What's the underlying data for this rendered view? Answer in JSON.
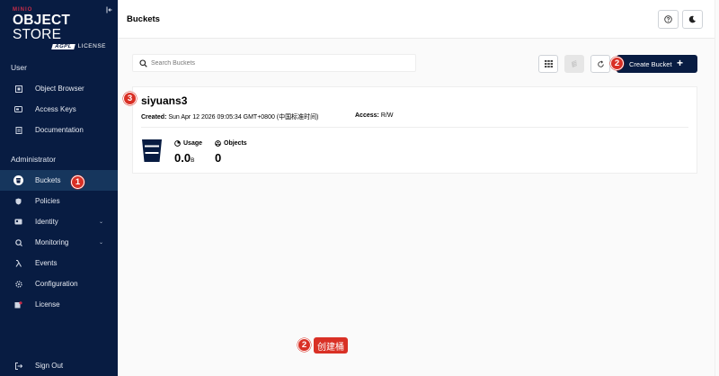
{
  "brand": {
    "min": "MINIO",
    "name_bold": "OBJECT",
    "name_light": " STORE",
    "license_badge": "AGPL",
    "license_label": "LICENSE"
  },
  "sidebar": {
    "user_section": "User",
    "admin_section": "Administrator",
    "items": [
      {
        "label": "Object Browser",
        "icon": "folder-icon"
      },
      {
        "label": "Access Keys",
        "icon": "key-icon"
      },
      {
        "label": "Documentation",
        "icon": "document-icon"
      },
      {
        "label": "Buckets",
        "icon": "bucket-icon",
        "active": true
      },
      {
        "label": "Policies",
        "icon": "shield-icon"
      },
      {
        "label": "Identity",
        "icon": "id-card-icon",
        "chevron": "⌄"
      },
      {
        "label": "Monitoring",
        "icon": "monitor-icon",
        "chevron": "⌄"
      },
      {
        "label": "Events",
        "icon": "lambda-icon"
      },
      {
        "label": "Configuration",
        "icon": "gear-icon"
      },
      {
        "label": "License",
        "icon": "license-icon"
      }
    ],
    "sign_out": "Sign Out"
  },
  "header": {
    "title": "Buckets",
    "help_icon": "help-icon",
    "theme_icon": "moon-icon"
  },
  "toolbar": {
    "search_placeholder": "Search Buckets",
    "create_label": "Create Bucket",
    "create_plus": "+"
  },
  "bucket": {
    "name": "siyuans3",
    "created_label": "Created:",
    "created_value": "Sun Apr 12 2026 09:05:34 GMT+0800 (中国标准时间)",
    "access_label": "Access:",
    "access_value": "R/W",
    "usage_label": "Usage",
    "usage_value": "0.0",
    "usage_unit": "B",
    "objects_label": "Objects",
    "objects_value": "0"
  },
  "annotations": {
    "n1": "1",
    "n2": "2",
    "n3": "3",
    "n2_text": "创建桶"
  },
  "colors": {
    "sidebar_bg": "#081c42",
    "sidebar_active": "#16365d",
    "brand_red": "#c72c48",
    "annotation_red": "#d93025",
    "primary_button": "#081c42"
  }
}
